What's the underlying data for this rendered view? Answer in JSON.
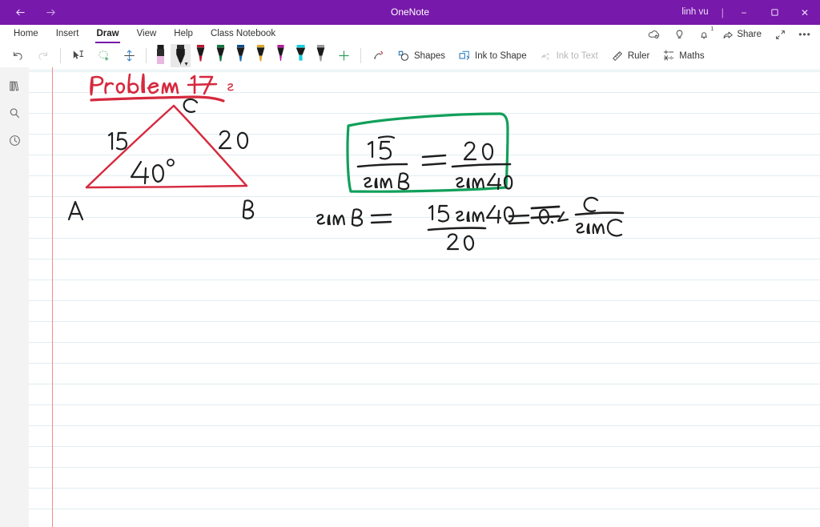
{
  "window": {
    "title": "OneNote",
    "user": "linh vu",
    "back_icon": "back-arrow-icon",
    "forward_icon": "forward-arrow-icon",
    "minimize_label": "−",
    "restore_label": "❐",
    "close_label": "✕",
    "separator": "|",
    "accent_color": "#7719aa"
  },
  "menubar": {
    "items": [
      {
        "label": "Home",
        "active": false
      },
      {
        "label": "Insert",
        "active": false
      },
      {
        "label": "Draw",
        "active": true
      },
      {
        "label": "View",
        "active": false
      },
      {
        "label": "Help",
        "active": false
      },
      {
        "label": "Class Notebook",
        "active": false
      }
    ],
    "right_actions": [
      {
        "name": "sync-icon",
        "label": ""
      },
      {
        "name": "lightbulb-icon",
        "label": ""
      },
      {
        "name": "bell-icon",
        "label": "",
        "badge": "1"
      },
      {
        "name": "share-button",
        "label": "Share"
      },
      {
        "name": "expand-icon",
        "label": ""
      },
      {
        "name": "more-options-icon",
        "label": "•••"
      }
    ]
  },
  "ribbon": {
    "undo_label": "Undo",
    "redo_label": "Redo",
    "lasso_label": "Lasso Select",
    "eraser_label": "Eraser",
    "space_label": "Insert Space",
    "add_pen_label": "+",
    "tools": [
      {
        "name": "ink-replay-icon",
        "label": "",
        "disabled": false
      },
      {
        "name": "shapes-button",
        "label": "Shapes",
        "disabled": false
      },
      {
        "name": "ink-to-shape-button",
        "label": "Ink to Shape",
        "disabled": false
      },
      {
        "name": "ink-to-text-button",
        "label": "Ink to Text",
        "disabled": true
      },
      {
        "name": "ruler-button",
        "label": "Ruler",
        "disabled": false
      },
      {
        "name": "maths-button",
        "label": "Maths",
        "disabled": false
      }
    ],
    "pens": [
      {
        "name": "pen-pink-highlighter",
        "color": "#e9b8e0",
        "cap": "#1b1b1b",
        "selected": false,
        "kind": "highlighter"
      },
      {
        "name": "pen-black",
        "color": "#1b1b1b",
        "cap": "#3a3a3a",
        "selected": true,
        "kind": "pen"
      },
      {
        "name": "pen-red",
        "color": "#c0152f",
        "cap": "#1b1b1b",
        "selected": false,
        "kind": "pen"
      },
      {
        "name": "pen-green",
        "color": "#0f7a42",
        "cap": "#1b1b1b",
        "selected": false,
        "kind": "pen"
      },
      {
        "name": "pen-blue",
        "color": "#0f4e8a",
        "cap": "#1b1b1b",
        "selected": false,
        "kind": "pen"
      },
      {
        "name": "pen-gold",
        "color": "#e0a72b",
        "cap": "#1b1b1b",
        "selected": false,
        "kind": "pen"
      },
      {
        "name": "pen-magenta",
        "color": "#b0209a",
        "cap": "#1b1b1b",
        "selected": false,
        "kind": "pen"
      },
      {
        "name": "highlighter-cyan",
        "color": "#16cfdc",
        "cap": "#1b1b1b",
        "selected": false,
        "kind": "highlighter"
      },
      {
        "name": "pen-silver",
        "color": "#9a9a9a",
        "cap": "#1b1b1b",
        "selected": false,
        "kind": "pen"
      }
    ]
  },
  "rail": {
    "items": [
      {
        "name": "notebooks-icon",
        "label": "Notebooks"
      },
      {
        "name": "search-icon",
        "label": "Search"
      },
      {
        "name": "recent-notes-icon",
        "label": "Recent Notes"
      }
    ]
  },
  "page": {
    "ink_color_red": "#d6293e",
    "ink_color_black": "#1f1f1f",
    "ink_color_green": "#11a05a",
    "rule_color": "#deecf0",
    "margin_color": "#f08b8b",
    "heading": "Problem 17",
    "heading_trailing": "s",
    "triangle": {
      "vertex_labels": {
        "a": "A",
        "b": "B",
        "c": "C"
      },
      "side_left": "15",
      "side_right": "20",
      "angle_a": "40°"
    },
    "boxed_equation": {
      "frac1_num": "15",
      "frac1_den": "sin B",
      "equals1": "=",
      "frac2_num": "20",
      "frac2_den": "sin40",
      "equals2": "=",
      "frac3_num": "c",
      "frac3_den": "sinC"
    },
    "work_line": {
      "lhs": "sin B",
      "equals1": "=",
      "frac_num": "15  sin40",
      "frac_den": "20",
      "equals2": "=",
      "result": "0.4"
    }
  }
}
